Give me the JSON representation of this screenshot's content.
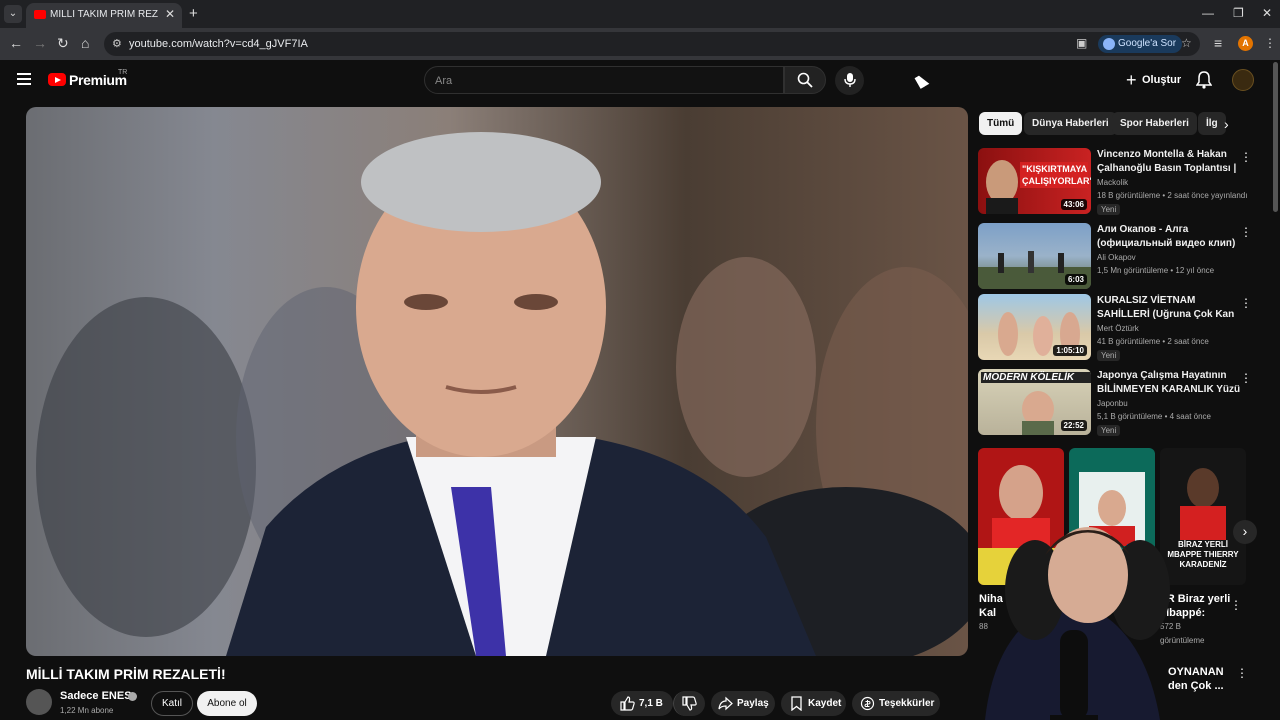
{
  "browser": {
    "tab_title": "MİLLİ TAKIM PRİM REZALETİ! - YouTube",
    "url": "youtube.com/watch?v=cd4_gJVF7IA",
    "ask_google": "Google'a Sor",
    "profile_letter": "A"
  },
  "youtube": {
    "brand": "Premium",
    "country": "TR",
    "search_placeholder": "Ara",
    "create_label": "Oluştur"
  },
  "video": {
    "title": "MİLLİ TAKIM PRİM REZALETİ!",
    "channel": "Sadece ENES",
    "subscribers": "1,22 Mn abone",
    "join_label": "Katıl",
    "subscribe_label": "Abone ol",
    "likes": "7,1 B",
    "share_label": "Paylaş",
    "save_label": "Kaydet",
    "thanks_label": "Teşekkürler"
  },
  "chips": [
    "Tümü",
    "Dünya Haberleri",
    "Spor Haberleri",
    "İlg"
  ],
  "recommendations": [
    {
      "title": "Vincenzo Montella & Hakan Çalhanoğlu Basın Toplantısı | ...",
      "channel": "Mackolik",
      "meta": "18 B görüntüleme • 2 saat önce yayınlandı",
      "badge": "Yeni",
      "duration": "43:06",
      "thumb_text": "\"KIŞKIRTMAYA ÇALIŞIYORLAR\""
    },
    {
      "title": "Али Окапов - Алга (официальный видео клип)",
      "channel": "Ali Okapov",
      "meta": "1,5 Mn görüntüleme • 12 yıl önce",
      "badge": "",
      "duration": "6:03",
      "thumb_text": ""
    },
    {
      "title": "KURALSIZ VİETNAM SAHİLLERİ (Uğruna Çok Kan Döküldü) 🇻🇳",
      "channel": "Mert Öztürk",
      "meta": "41 B görüntüleme • 2 saat önce",
      "badge": "Yeni",
      "duration": "1:05:10",
      "thumb_text": ""
    },
    {
      "title": "Japonya Çalışma Hayatının BİLİNMEYEN KARANLIK Yüzü",
      "channel": "Japonbu",
      "meta": "5,1 B görüntüleme • 4 saat önce",
      "badge": "Yeni",
      "duration": "22:52",
      "thumb_text": "MODERN KÖLELİK"
    }
  ],
  "shorts": {
    "cap1_a": "Niha",
    "cap1_b": "Kal",
    "cap1_c": "88",
    "cap3_a": "TR Biraz yerli",
    "cap3_b": "Mbappé:",
    "cap3_c": "572 B",
    "cap3_d": "görüntüleme",
    "cap4_a": "OYNANAN",
    "cap4_b": "den Çok ...",
    "short3_text": "BİRAZ YERLİ MBAPPE THIERRY KARADENİZ"
  }
}
